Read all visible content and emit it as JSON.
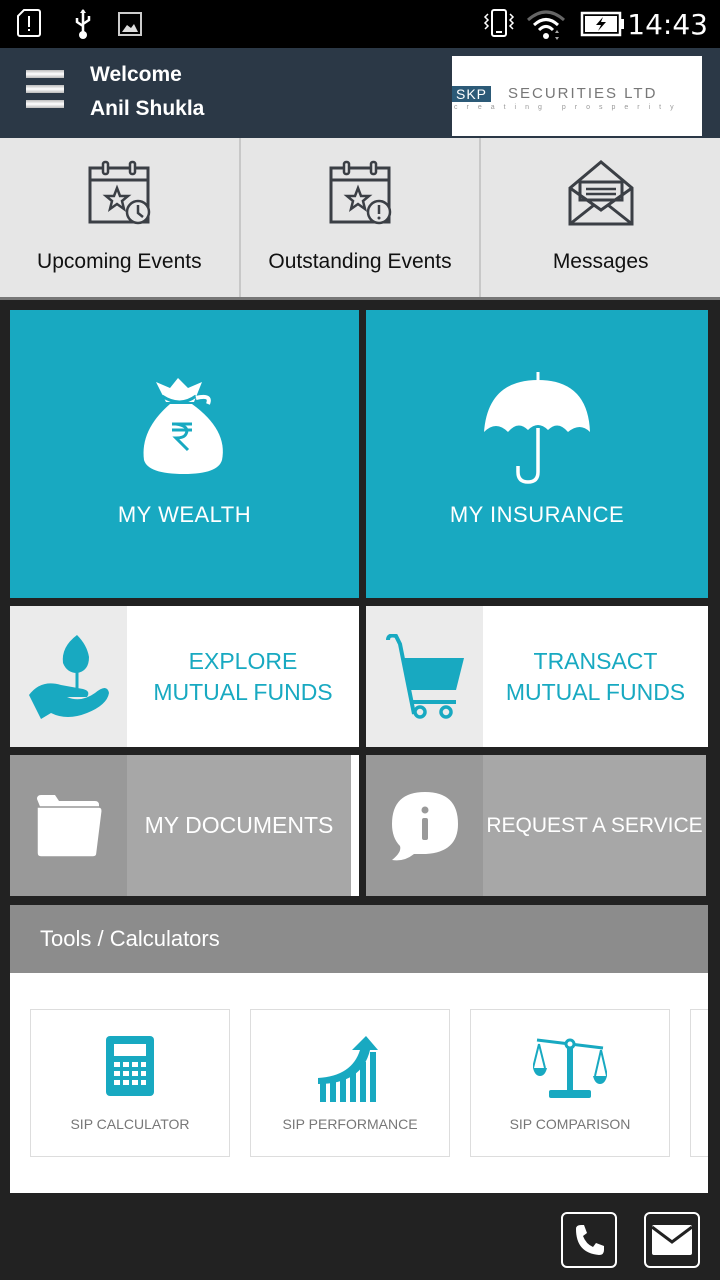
{
  "statusbar": {
    "time": "14:43",
    "icons": [
      "sd-alert-icon",
      "usb-icon",
      "image-icon",
      "vibrate-icon",
      "wifi-icon",
      "battery-charging-icon"
    ]
  },
  "appbar": {
    "welcome": "Welcome",
    "user_name": "Anil Shukla",
    "logo": {
      "brand": "SKP",
      "name": "SECURITIES LTD",
      "tagline": "creating prosperity"
    }
  },
  "quickbar": [
    {
      "label": "Upcoming Events",
      "icon": "calendar-clock-icon"
    },
    {
      "label": "Outstanding Events",
      "icon": "calendar-alert-icon"
    },
    {
      "label": "Messages",
      "icon": "envelope-open-icon"
    }
  ],
  "tiles": {
    "wealth": {
      "label": "MY WEALTH",
      "icon": "money-bag-rupee-icon"
    },
    "insurance": {
      "label": "MY INSURANCE",
      "icon": "umbrella-icon"
    },
    "explore": {
      "line1": "EXPLORE",
      "line2": "MUTUAL FUNDS",
      "icon": "plant-hand-icon"
    },
    "transact": {
      "line1": "TRANSACT",
      "line2": "MUTUAL FUNDS",
      "icon": "cart-icon"
    },
    "documents": {
      "label": "MY DOCUMENTS",
      "icon": "folder-icon"
    },
    "service": {
      "label": "REQUEST A SERVICE",
      "icon": "info-bubble-icon"
    }
  },
  "tools": {
    "title": "Tools / Calculators",
    "items": [
      {
        "label": "SIP CALCULATOR",
        "icon": "calculator-icon"
      },
      {
        "label": "SIP PERFORMANCE",
        "icon": "growth-chart-icon"
      },
      {
        "label": "SIP COMPARISON",
        "icon": "scale-icon"
      }
    ]
  },
  "footer": {
    "buttons": [
      "phone-icon",
      "mail-icon"
    ]
  },
  "colors": {
    "accent": "#18a9c1",
    "appbar": "#2b3846",
    "background": "#222222"
  }
}
